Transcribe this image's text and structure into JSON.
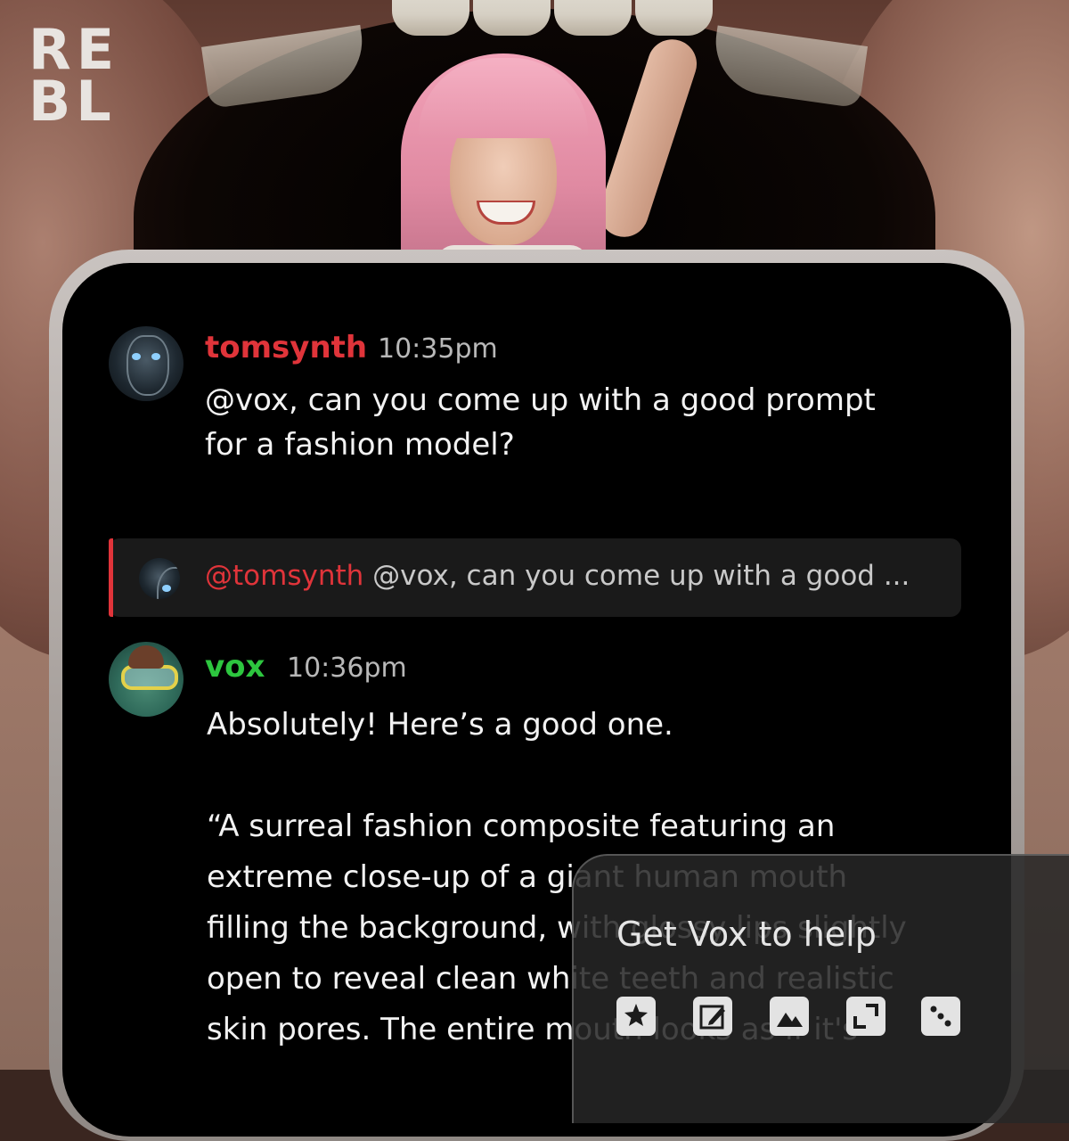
{
  "brand": {
    "logo_line1": "RE",
    "logo_line2": "BL"
  },
  "messages": [
    {
      "username": "tomsynth",
      "username_color": "#e0343a",
      "time": "10:35pm",
      "avatar": "armored-creature-avatar",
      "text": "@vox, can you come up with a good prompt\nfor a fashion model?"
    },
    {
      "username": "vox",
      "username_color": "#2dc63f",
      "time": "10:36pm",
      "avatar": "diver-goggles-avatar",
      "text": "Absolutely! Here’s a good one.\n\n“A surreal fashion composite featuring an\nextreme close-up of a giant human mouth\nfilling the background, with glossy lips slightly\nopen to reveal clean white teeth and realistic\nskin pores. The entire mouth looks as if it's"
    }
  ],
  "reply": {
    "mention": "@tomsynth",
    "preview": " @vox, can you come up with a good ..."
  },
  "help_panel": {
    "title": "Get Vox to help",
    "tools": [
      "sparkle-image-icon",
      "edit-image-icon",
      "image-landscape-icon",
      "expand-icon",
      "dice-icon"
    ]
  },
  "colors": {
    "accent_red": "#e0343a",
    "accent_green": "#2dc63f",
    "screen_bg": "#000000",
    "reply_bg": "#1a1a1a"
  }
}
